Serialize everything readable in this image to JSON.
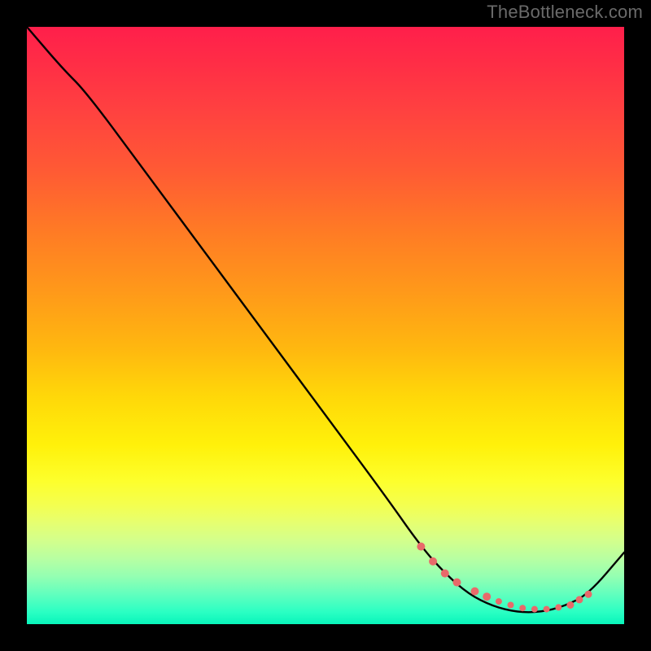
{
  "watermark": "TheBottleneck.com",
  "chart_data": {
    "type": "line",
    "title": "",
    "xlabel": "",
    "ylabel": "",
    "xlim": [
      0,
      100
    ],
    "ylim": [
      0,
      100
    ],
    "series": [
      {
        "name": "curve",
        "x": [
          0,
          6,
          10,
          20,
          30,
          40,
          50,
          60,
          66,
          70,
          74,
          78,
          82,
          86,
          90,
          94,
          100
        ],
        "y": [
          100,
          93,
          89,
          75.5,
          62,
          48.5,
          35,
          21.5,
          13,
          8.5,
          5,
          3,
          2,
          2,
          3,
          5,
          12
        ]
      }
    ],
    "markers": {
      "name": "highlight-dots",
      "color": "#e86a6a",
      "x": [
        66,
        68,
        70,
        72,
        75,
        77,
        79,
        81,
        83,
        85,
        87,
        89,
        91,
        92.5,
        94
      ],
      "y": [
        13,
        10.5,
        8.5,
        7,
        5.5,
        4.6,
        3.8,
        3.2,
        2.7,
        2.5,
        2.5,
        2.8,
        3.2,
        4.1,
        5
      ],
      "radii": [
        5,
        5,
        5,
        5,
        5,
        5,
        4,
        4,
        4,
        4,
        4,
        4,
        4.5,
        4.5,
        4.5
      ]
    },
    "gradient_stops": [
      {
        "pos": 0.0,
        "color": "#ff1f4b"
      },
      {
        "pos": 0.5,
        "color": "#ffc40a"
      },
      {
        "pos": 0.8,
        "color": "#f4ff4f"
      },
      {
        "pos": 1.0,
        "color": "#08f5bb"
      }
    ]
  }
}
